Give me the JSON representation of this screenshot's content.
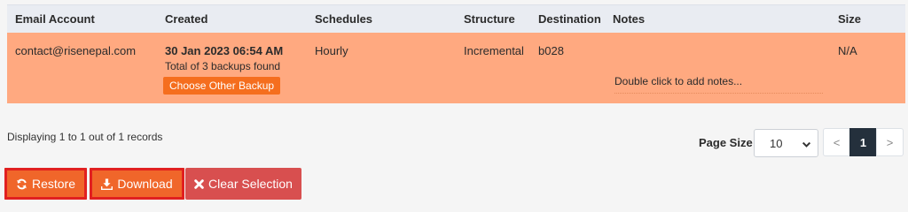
{
  "table": {
    "headers": [
      "Email Account",
      "Created",
      "Schedules",
      "Structure",
      "Destination",
      "Notes",
      "Size"
    ],
    "row": {
      "email": "contact@risenepal.com",
      "created_date": "30 Jan 2023 06:54 AM",
      "created_sub": "Total of 3 backups found",
      "choose_label": "Choose Other Backup",
      "schedule": "Hourly",
      "structure": "Incremental",
      "destination": "b028",
      "notes_placeholder": "Double click to add notes...",
      "size": "N/A"
    }
  },
  "footer": {
    "displaying": "Displaying 1 to 1 out of 1 records",
    "page_size_label": "Page Size",
    "page_size_value": "10",
    "pager": {
      "prev": "<",
      "current": "1",
      "next": ">"
    }
  },
  "actions": {
    "restore": "Restore",
    "download": "Download",
    "clear": "Clear Selection"
  },
  "colors": {
    "row_highlight": "#ffa980",
    "action_orange": "#f0662a",
    "highlight_red": "#e12020",
    "clear_red": "#d84f4f",
    "pager_active": "#24303c"
  },
  "icons": {
    "restore": "refresh-icon",
    "download": "download-icon",
    "clear": "x-icon",
    "select": "chevron-down-icon"
  }
}
